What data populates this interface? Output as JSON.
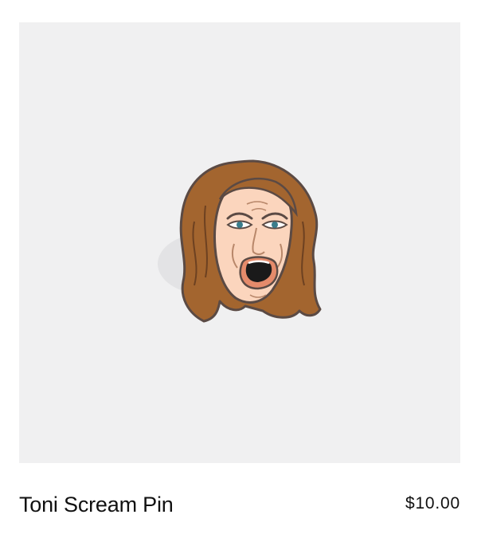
{
  "product": {
    "title": "Toni Scream Pin",
    "price": "$10.00",
    "image_icon": "enamel-pin-face-icon"
  },
  "colors": {
    "image_background": "#f0f0f1",
    "text": "#111111",
    "hair": "#a3652f",
    "skin": "#fbd5bd",
    "metal_outline": "#5b4a44"
  }
}
